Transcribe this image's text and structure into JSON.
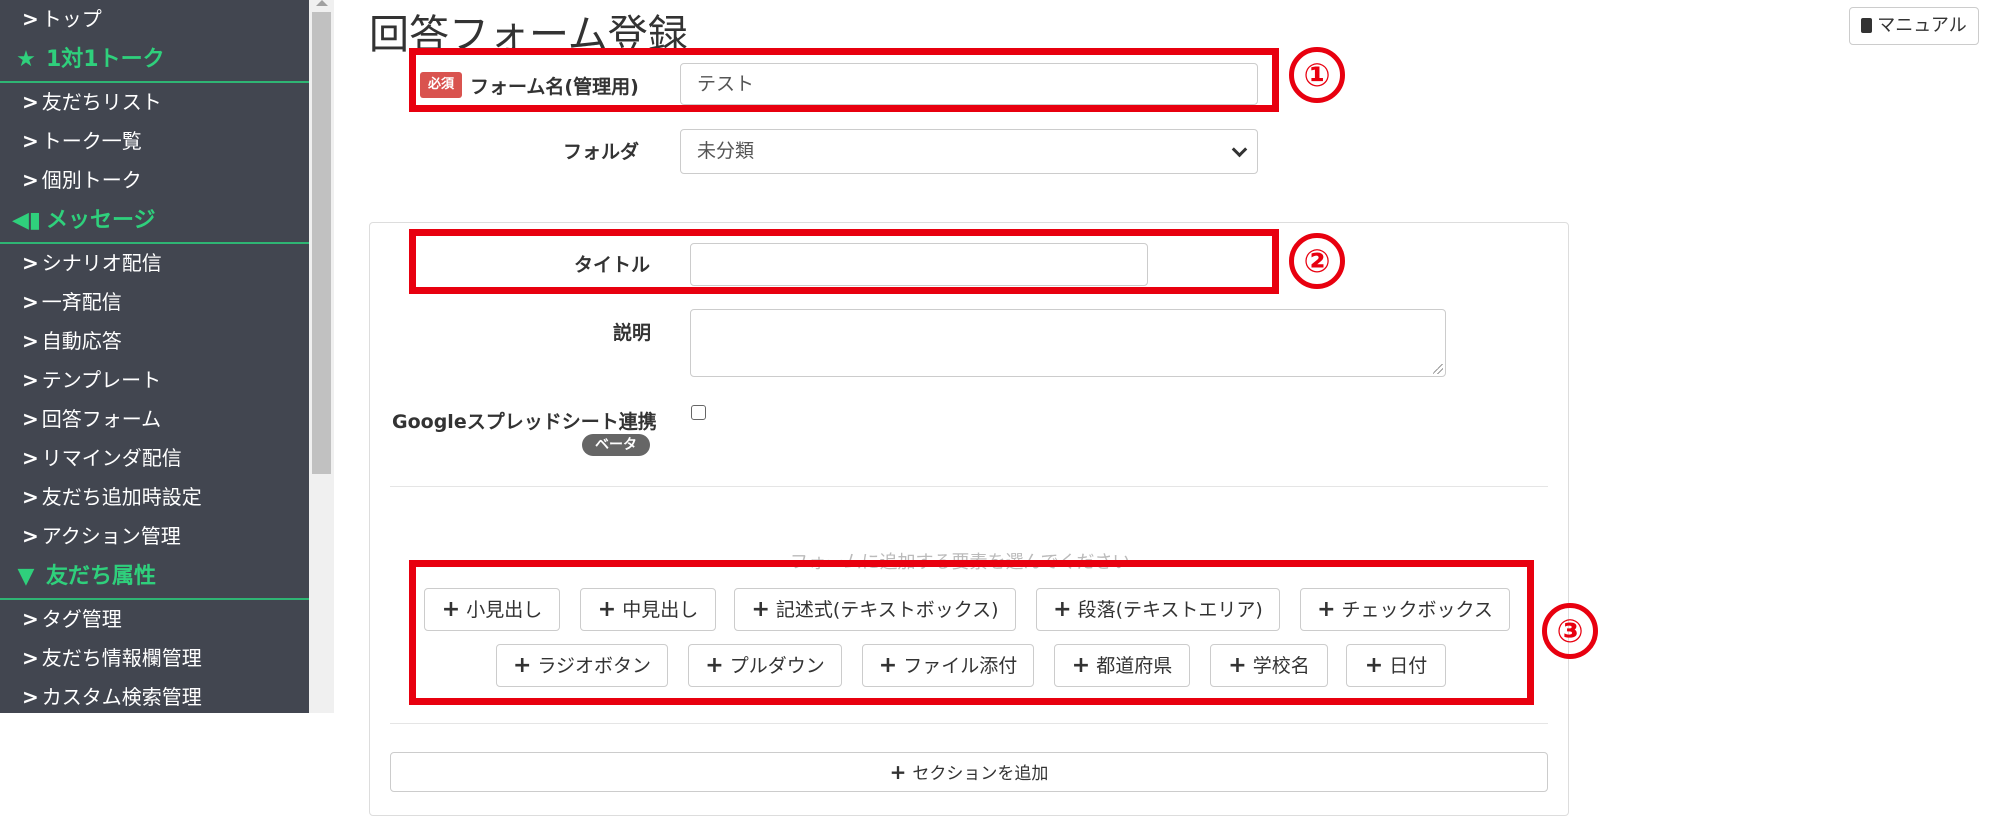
{
  "sidebar": {
    "items": [
      {
        "type": "link",
        "label": "トップ"
      },
      {
        "type": "section",
        "label": "1対1トーク",
        "icon": "star-icon"
      },
      {
        "type": "link",
        "label": "友だちリスト"
      },
      {
        "type": "link",
        "label": "トーク一覧"
      },
      {
        "type": "link",
        "label": "個別トーク"
      },
      {
        "type": "section",
        "label": "メッセージ",
        "icon": "megaphone-icon"
      },
      {
        "type": "link",
        "label": "シナリオ配信"
      },
      {
        "type": "link",
        "label": "一斉配信"
      },
      {
        "type": "link",
        "label": "自動応答"
      },
      {
        "type": "link",
        "label": "テンプレート"
      },
      {
        "type": "link",
        "label": "回答フォーム"
      },
      {
        "type": "link",
        "label": "リマインダ配信"
      },
      {
        "type": "link",
        "label": "友だち追加時設定"
      },
      {
        "type": "link",
        "label": "アクション管理"
      },
      {
        "type": "section",
        "label": "友だち属性",
        "icon": "filter-icon"
      },
      {
        "type": "link",
        "label": "タグ管理"
      },
      {
        "type": "link",
        "label": "友だち情報欄管理"
      },
      {
        "type": "link",
        "label": "カスタム検索管理"
      }
    ]
  },
  "header": {
    "title": "回答フォーム登録",
    "manual_label": "マニュアル"
  },
  "form": {
    "required_badge": "必須",
    "name_label": "フォーム名(管理用)",
    "name_value": "テスト",
    "folder_label": "フォルダ",
    "folder_value": "未分類"
  },
  "section": {
    "title_label": "タイトル",
    "title_value": "",
    "description_label": "説明",
    "gs_label": "Googleスプレッドシート連携",
    "beta_label": "ベータ",
    "hint": "フォームに追加する要素を選んでください",
    "element_buttons": [
      "小見出し",
      "中見出し",
      "記述式(テキストボックス)",
      "段落(テキストエリア)",
      "チェックボックス",
      "ラジオボタン",
      "プルダウン",
      "ファイル添付",
      "都道府県",
      "学校名",
      "日付"
    ]
  },
  "add_section_label": "セクションを追加",
  "annotations": [
    "①",
    "②",
    "③"
  ],
  "colors": {
    "sidebar_bg": "#424650",
    "sidebar_section": "#2fd07c",
    "required": "#d9534f",
    "annotation_red": "#e8000f"
  }
}
